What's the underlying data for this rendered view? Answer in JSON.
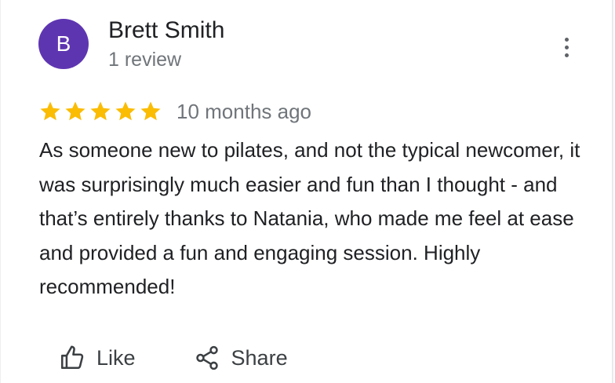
{
  "review": {
    "author": {
      "initial": "B",
      "name": "Brett Smith",
      "review_count": "1 review",
      "avatar_color": "#5e35b1"
    },
    "rating": 5,
    "max_rating": 5,
    "star_color": "#fbbc04",
    "date": "10 months ago",
    "text": "As someone new to pilates, and not the typical newcomer, it was surprisingly much easier and fun than I thought - and that’s entirely thanks to Natania, who made me feel at ease and provided a fun and engaging session. Highly recommended!"
  },
  "actions": {
    "like_label": "Like",
    "like_icon": "thumb-up-icon",
    "share_label": "Share",
    "share_icon": "share-icon"
  },
  "menu": {
    "icon": "more-vert-icon"
  }
}
